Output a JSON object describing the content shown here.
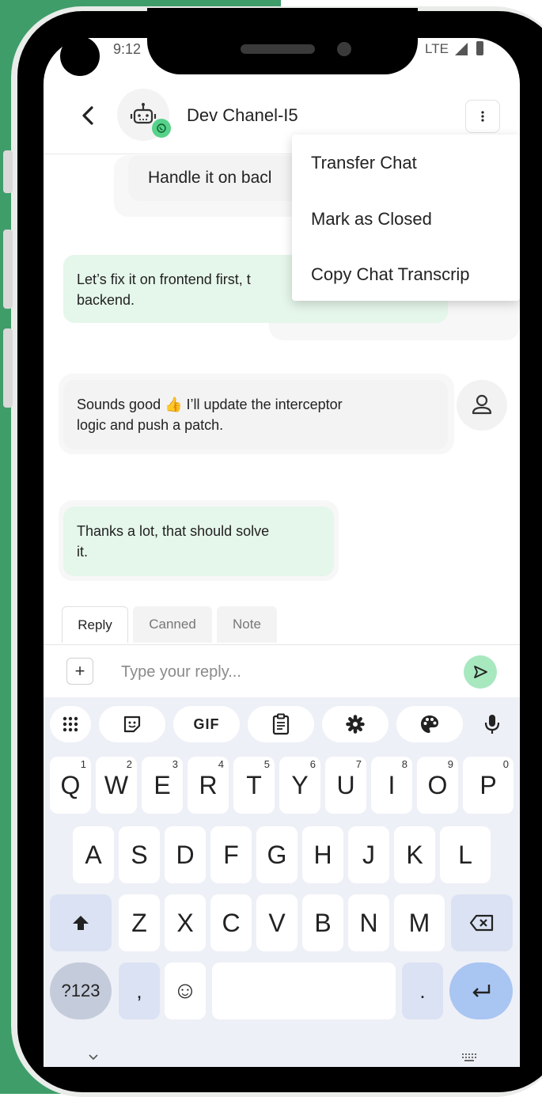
{
  "status_bar": {
    "time": "9:12",
    "network": "LTE"
  },
  "header": {
    "title": "Dev Chanel-I5"
  },
  "messages": [
    {
      "text": "Handle it on bacl"
    },
    {
      "text": "Let’s fix it on frontend first, t"
    },
    {
      "text": "backend."
    },
    {
      "text": "Sounds good 👍 I’ll update the interceptor"
    },
    {
      "text": "logic and push a patch."
    },
    {
      "text": "Thanks a lot, that should solve"
    },
    {
      "text": "it."
    }
  ],
  "menu": {
    "items": [
      {
        "label": "Transfer Chat"
      },
      {
        "label": "Mark as Closed"
      },
      {
        "label": "Copy Chat Transcrip"
      }
    ]
  },
  "tabs": [
    {
      "label": "Reply",
      "active": true
    },
    {
      "label": "Canned",
      "active": false
    },
    {
      "label": "Note",
      "active": false
    }
  ],
  "composer": {
    "add_label": "+",
    "placeholder": "Type your reply..."
  },
  "keyboard": {
    "toolbar": [
      {
        "icon": "apps-grid-icon"
      },
      {
        "icon": "sticker-icon"
      },
      {
        "label": "GIF"
      },
      {
        "icon": "clipboard-icon"
      },
      {
        "icon": "settings-gear-icon"
      },
      {
        "icon": "palette-icon"
      },
      {
        "icon": "microphone-icon"
      }
    ],
    "row1": [
      {
        "key": "Q",
        "hint": "1"
      },
      {
        "key": "W",
        "hint": "2"
      },
      {
        "key": "E",
        "hint": "3"
      },
      {
        "key": "R",
        "hint": "4"
      },
      {
        "key": "T",
        "hint": "5"
      },
      {
        "key": "Y",
        "hint": "6"
      },
      {
        "key": "U",
        "hint": "7"
      },
      {
        "key": "I",
        "hint": "8"
      },
      {
        "key": "O",
        "hint": "9"
      },
      {
        "key": "P",
        "hint": "0"
      }
    ],
    "row2": [
      "A",
      "S",
      "D",
      "F",
      "G",
      "H",
      "J",
      "K",
      "L"
    ],
    "row3": [
      "Z",
      "X",
      "C",
      "V",
      "B",
      "N",
      "M"
    ],
    "numbers_label": "?123",
    "comma": ",",
    "period": ".",
    "emoji_glyph": "☺"
  }
}
